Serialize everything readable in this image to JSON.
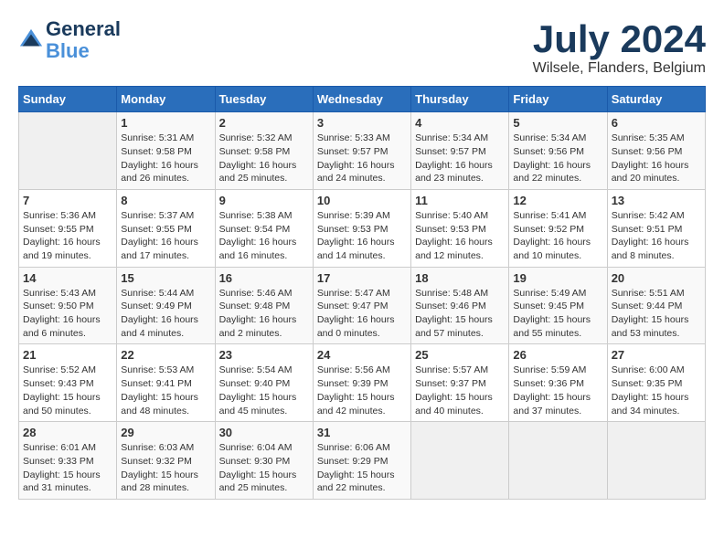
{
  "header": {
    "logo_line1": "General",
    "logo_line2": "Blue",
    "month_title": "July 2024",
    "location": "Wilsele, Flanders, Belgium"
  },
  "calendar": {
    "days_of_week": [
      "Sunday",
      "Monday",
      "Tuesday",
      "Wednesday",
      "Thursday",
      "Friday",
      "Saturday"
    ],
    "weeks": [
      [
        {
          "day": "",
          "info": ""
        },
        {
          "day": "1",
          "info": "Sunrise: 5:31 AM\nSunset: 9:58 PM\nDaylight: 16 hours\nand 26 minutes."
        },
        {
          "day": "2",
          "info": "Sunrise: 5:32 AM\nSunset: 9:58 PM\nDaylight: 16 hours\nand 25 minutes."
        },
        {
          "day": "3",
          "info": "Sunrise: 5:33 AM\nSunset: 9:57 PM\nDaylight: 16 hours\nand 24 minutes."
        },
        {
          "day": "4",
          "info": "Sunrise: 5:34 AM\nSunset: 9:57 PM\nDaylight: 16 hours\nand 23 minutes."
        },
        {
          "day": "5",
          "info": "Sunrise: 5:34 AM\nSunset: 9:56 PM\nDaylight: 16 hours\nand 22 minutes."
        },
        {
          "day": "6",
          "info": "Sunrise: 5:35 AM\nSunset: 9:56 PM\nDaylight: 16 hours\nand 20 minutes."
        }
      ],
      [
        {
          "day": "7",
          "info": "Sunrise: 5:36 AM\nSunset: 9:55 PM\nDaylight: 16 hours\nand 19 minutes."
        },
        {
          "day": "8",
          "info": "Sunrise: 5:37 AM\nSunset: 9:55 PM\nDaylight: 16 hours\nand 17 minutes."
        },
        {
          "day": "9",
          "info": "Sunrise: 5:38 AM\nSunset: 9:54 PM\nDaylight: 16 hours\nand 16 minutes."
        },
        {
          "day": "10",
          "info": "Sunrise: 5:39 AM\nSunset: 9:53 PM\nDaylight: 16 hours\nand 14 minutes."
        },
        {
          "day": "11",
          "info": "Sunrise: 5:40 AM\nSunset: 9:53 PM\nDaylight: 16 hours\nand 12 minutes."
        },
        {
          "day": "12",
          "info": "Sunrise: 5:41 AM\nSunset: 9:52 PM\nDaylight: 16 hours\nand 10 minutes."
        },
        {
          "day": "13",
          "info": "Sunrise: 5:42 AM\nSunset: 9:51 PM\nDaylight: 16 hours\nand 8 minutes."
        }
      ],
      [
        {
          "day": "14",
          "info": "Sunrise: 5:43 AM\nSunset: 9:50 PM\nDaylight: 16 hours\nand 6 minutes."
        },
        {
          "day": "15",
          "info": "Sunrise: 5:44 AM\nSunset: 9:49 PM\nDaylight: 16 hours\nand 4 minutes."
        },
        {
          "day": "16",
          "info": "Sunrise: 5:46 AM\nSunset: 9:48 PM\nDaylight: 16 hours\nand 2 minutes."
        },
        {
          "day": "17",
          "info": "Sunrise: 5:47 AM\nSunset: 9:47 PM\nDaylight: 16 hours\nand 0 minutes."
        },
        {
          "day": "18",
          "info": "Sunrise: 5:48 AM\nSunset: 9:46 PM\nDaylight: 15 hours\nand 57 minutes."
        },
        {
          "day": "19",
          "info": "Sunrise: 5:49 AM\nSunset: 9:45 PM\nDaylight: 15 hours\nand 55 minutes."
        },
        {
          "day": "20",
          "info": "Sunrise: 5:51 AM\nSunset: 9:44 PM\nDaylight: 15 hours\nand 53 minutes."
        }
      ],
      [
        {
          "day": "21",
          "info": "Sunrise: 5:52 AM\nSunset: 9:43 PM\nDaylight: 15 hours\nand 50 minutes."
        },
        {
          "day": "22",
          "info": "Sunrise: 5:53 AM\nSunset: 9:41 PM\nDaylight: 15 hours\nand 48 minutes."
        },
        {
          "day": "23",
          "info": "Sunrise: 5:54 AM\nSunset: 9:40 PM\nDaylight: 15 hours\nand 45 minutes."
        },
        {
          "day": "24",
          "info": "Sunrise: 5:56 AM\nSunset: 9:39 PM\nDaylight: 15 hours\nand 42 minutes."
        },
        {
          "day": "25",
          "info": "Sunrise: 5:57 AM\nSunset: 9:37 PM\nDaylight: 15 hours\nand 40 minutes."
        },
        {
          "day": "26",
          "info": "Sunrise: 5:59 AM\nSunset: 9:36 PM\nDaylight: 15 hours\nand 37 minutes."
        },
        {
          "day": "27",
          "info": "Sunrise: 6:00 AM\nSunset: 9:35 PM\nDaylight: 15 hours\nand 34 minutes."
        }
      ],
      [
        {
          "day": "28",
          "info": "Sunrise: 6:01 AM\nSunset: 9:33 PM\nDaylight: 15 hours\nand 31 minutes."
        },
        {
          "day": "29",
          "info": "Sunrise: 6:03 AM\nSunset: 9:32 PM\nDaylight: 15 hours\nand 28 minutes."
        },
        {
          "day": "30",
          "info": "Sunrise: 6:04 AM\nSunset: 9:30 PM\nDaylight: 15 hours\nand 25 minutes."
        },
        {
          "day": "31",
          "info": "Sunrise: 6:06 AM\nSunset: 9:29 PM\nDaylight: 15 hours\nand 22 minutes."
        },
        {
          "day": "",
          "info": ""
        },
        {
          "day": "",
          "info": ""
        },
        {
          "day": "",
          "info": ""
        }
      ]
    ]
  }
}
